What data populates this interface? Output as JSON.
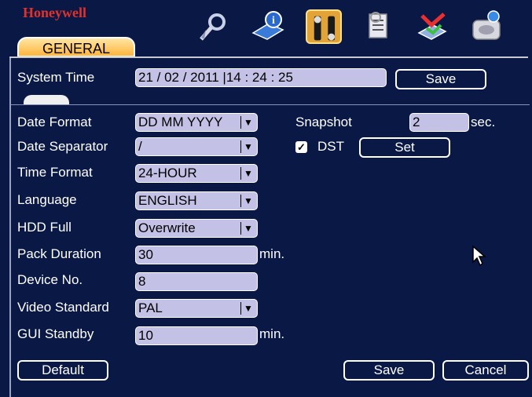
{
  "brand": "Honeywell",
  "tab": {
    "label": "GENERAL"
  },
  "icons": [
    "search-icon",
    "info-icon",
    "tools-icon",
    "advanced-icon",
    "backup-icon",
    "shutdown-icon"
  ],
  "system_time": {
    "label": "System Time",
    "value": "21 / 02 / 2011   |14 : 24 : 25",
    "save_label": "Save"
  },
  "fields": {
    "date_format": {
      "label": "Date Format",
      "value": "DD MM YYYY"
    },
    "date_separator": {
      "label": "Date Separator",
      "value": "/"
    },
    "time_format": {
      "label": "Time Format",
      "value": "24-HOUR"
    },
    "language": {
      "label": "Language",
      "value": "ENGLISH"
    },
    "hdd_full": {
      "label": "HDD Full",
      "value": "Overwrite"
    },
    "pack_duration": {
      "label": "Pack Duration",
      "value": "30",
      "unit": "min."
    },
    "device_no": {
      "label": "Device No.",
      "value": "8"
    },
    "video_standard": {
      "label": "Video Standard",
      "value": "PAL"
    },
    "gui_standby": {
      "label": "GUI Standby",
      "value": "10",
      "unit": "min."
    }
  },
  "snapshot": {
    "label": "Snapshot",
    "value": "2",
    "unit": "sec."
  },
  "dst": {
    "label": "DST",
    "checked": true,
    "set_label": "Set"
  },
  "footer": {
    "default_label": "Default",
    "save_label": "Save",
    "cancel_label": "Cancel"
  },
  "colors": {
    "background": "#0a1846",
    "field": "#c4c1e7",
    "tab_active": "#ffb53d",
    "brand": "#e0322c"
  }
}
